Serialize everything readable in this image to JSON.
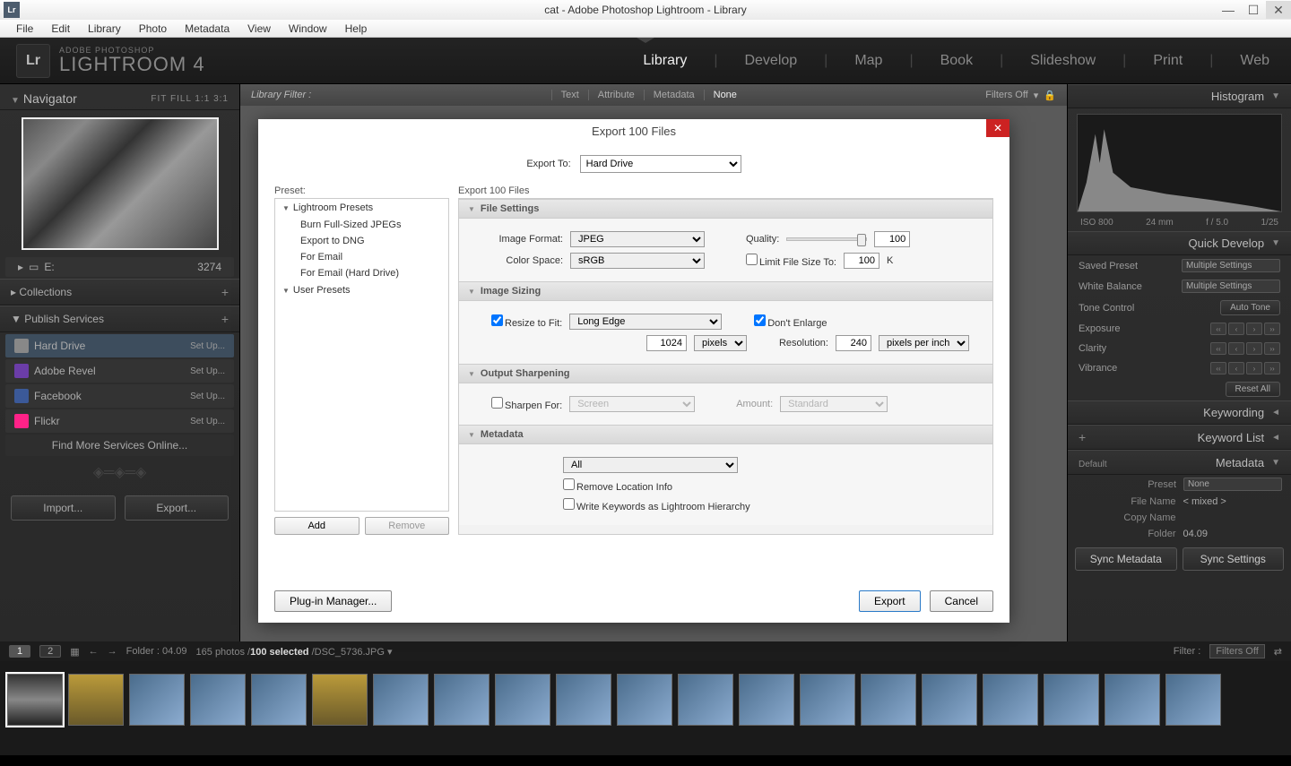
{
  "window": {
    "title": "cat - Adobe Photoshop Lightroom - Library"
  },
  "menubar": [
    "File",
    "Edit",
    "Library",
    "Photo",
    "Metadata",
    "View",
    "Window",
    "Help"
  ],
  "brand": {
    "sub": "ADOBE PHOTOSHOP",
    "main": "LIGHTROOM 4",
    "lr": "Lr"
  },
  "modules": [
    "Library",
    "Develop",
    "Map",
    "Book",
    "Slideshow",
    "Print",
    "Web"
  ],
  "filterbar": {
    "label": "Library Filter :",
    "items": [
      "Text",
      "Attribute",
      "Metadata",
      "None"
    ],
    "active": "None",
    "filters_off": "Filters Off"
  },
  "navigator": {
    "title": "Navigator",
    "opts": "FIT   FILL   1:1   3:1"
  },
  "folder": {
    "drive": "E:",
    "count": "3274"
  },
  "collections": {
    "title": "Collections"
  },
  "publish": {
    "title": "Publish Services",
    "items": [
      {
        "name": "Hard Drive",
        "setup": "Set Up...",
        "color": "#888"
      },
      {
        "name": "Adobe Revel",
        "setup": "Set Up...",
        "color": "#6b3da8"
      },
      {
        "name": "Facebook",
        "setup": "Set Up...",
        "color": "#3b5998"
      },
      {
        "name": "Flickr",
        "setup": "Set Up...",
        "color": "#ff2288"
      }
    ],
    "find": "Find More Services Online..."
  },
  "lbuttons": {
    "import": "Import...",
    "export": "Export..."
  },
  "histogram": {
    "title": "Histogram",
    "iso": "ISO 800",
    "focal": "24 mm",
    "f": "f / 5.0",
    "shutter": "1/25"
  },
  "quickdev": {
    "title": "Quick Develop",
    "saved_preset_lbl": "Saved Preset",
    "saved_preset": "Multiple Settings",
    "wb_lbl": "White Balance",
    "wb": "Multiple Settings",
    "tone_lbl": "Tone Control",
    "auto": "Auto Tone",
    "exposure": "Exposure",
    "clarity": "Clarity",
    "vibrance": "Vibrance",
    "reset": "Reset All"
  },
  "keywording": {
    "title": "Keywording"
  },
  "keywordlist": {
    "title": "Keyword List"
  },
  "metadata": {
    "title": "Metadata",
    "mode": "Default",
    "preset_lbl": "Preset",
    "preset": "None",
    "filename_lbl": "File Name",
    "filename": "< mixed >",
    "copy_lbl": "Copy Name",
    "copy": "",
    "folder_lbl": "Folder",
    "folder": "04.09"
  },
  "sync": {
    "meta": "Sync Metadata",
    "settings": "Sync Settings"
  },
  "infobar": {
    "pg1": "1",
    "pg2": "2",
    "folder": "Folder : 04.09",
    "count": "165 photos /",
    "sel": "100 selected",
    "file": " /DSC_5736.JPG",
    "filterlbl": "Filter :",
    "filters": "Filters Off"
  },
  "dialog": {
    "title": "Export 100 Files",
    "export_to_lbl": "Export To:",
    "export_to": "Hard Drive",
    "preset_lbl": "Preset:",
    "presets_grp1": "Lightroom Presets",
    "presets": [
      "Burn Full-Sized JPEGs",
      "Export to DNG",
      "For Email",
      "For Email (Hard Drive)"
    ],
    "presets_grp2": "User Presets",
    "add": "Add",
    "remove": "Remove",
    "subtitle": "Export 100 Files",
    "s1": "File Settings",
    "fmt_lbl": "Image Format:",
    "fmt": "JPEG",
    "quality_lbl": "Quality:",
    "quality": "100",
    "cs_lbl": "Color Space:",
    "cs": "sRGB",
    "limit_lbl": "Limit File Size To:",
    "limit_val": "100",
    "limit_unit": "K",
    "s2": "Image Sizing",
    "resize_lbl": "Resize to Fit:",
    "resize": "Long Edge",
    "dont_enlarge": "Don't Enlarge",
    "dim": "1024",
    "dim_unit": "pixels",
    "res_lbl": "Resolution:",
    "res": "240",
    "res_unit": "pixels per inch",
    "s3": "Output Sharpening",
    "sharpen_lbl": "Sharpen For:",
    "sharpen": "Screen",
    "amount_lbl": "Amount:",
    "amount": "Standard",
    "s4": "Metadata",
    "meta_sel": "All",
    "remove_loc": "Remove Location Info",
    "write_kw": "Write Keywords as Lightroom Hierarchy",
    "plugin": "Plug-in Manager...",
    "export_btn": "Export",
    "cancel": "Cancel"
  }
}
